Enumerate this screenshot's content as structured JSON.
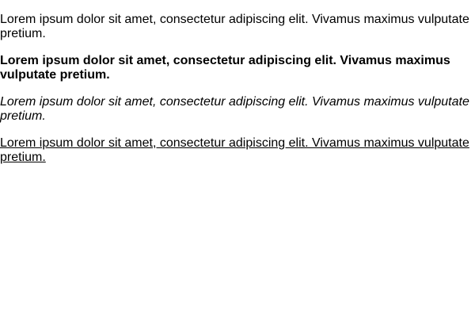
{
  "paragraphs": {
    "regular": "Lorem ipsum dolor sit amet, consectetur adipiscing elit. Vivamus maximus vulputate pretium.",
    "bold": "Lorem ipsum dolor sit amet, consectetur adipiscing elit. Vivamus maximus vulputate pretium.",
    "italic": "Lorem ipsum dolor sit amet, consectetur adipiscing elit. Vivamus maximus vulputate pretium.",
    "underline": "Lorem ipsum dolor sit amet, consectetur adipiscing elit. Vivamus maximus vulputate pretium."
  }
}
